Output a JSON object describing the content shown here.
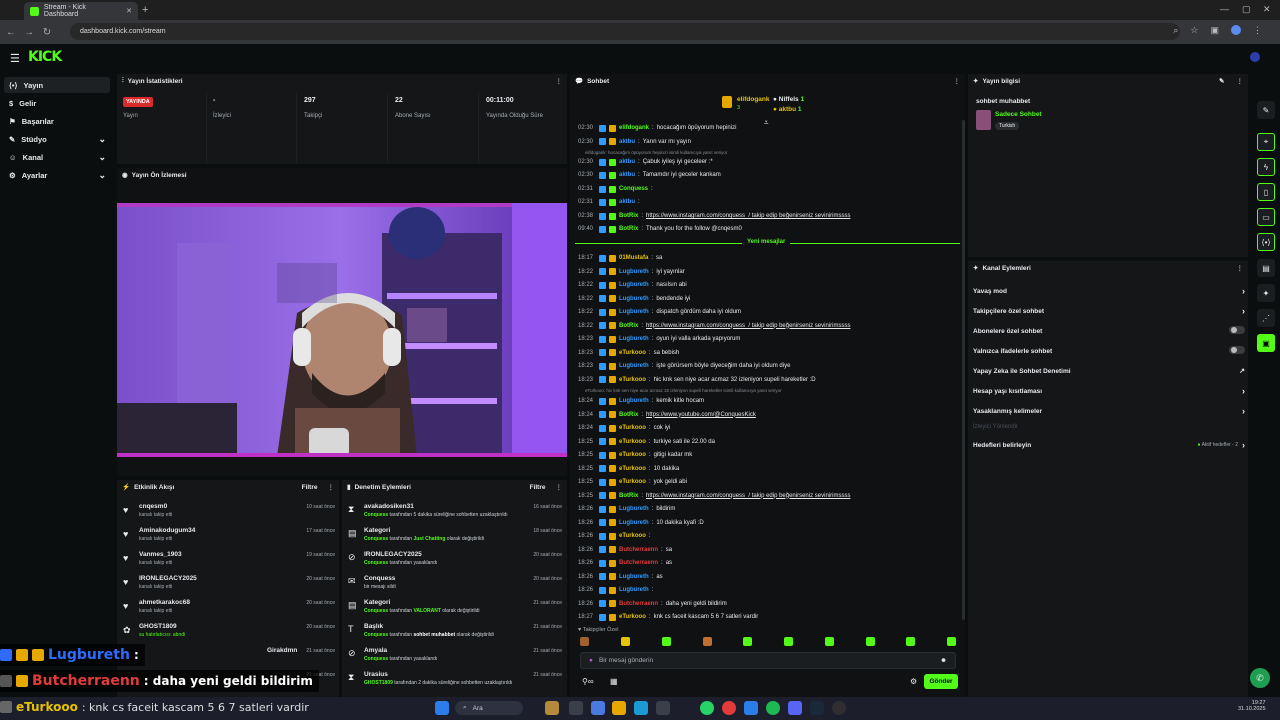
{
  "browser": {
    "tab_title": "Stream - Kick Dashboard",
    "url": "dashboard.kick.com/stream"
  },
  "brand": {
    "logo": "KICK",
    "accent": "#53fc18"
  },
  "sidebar": {
    "items": [
      {
        "label": "Yayın",
        "icon": "stream-icon"
      },
      {
        "label": "Gelir",
        "icon": "revenue-icon"
      },
      {
        "label": "Başarılar",
        "icon": "achievements-icon"
      },
      {
        "label": "Stüdyo",
        "icon": "studio-icon"
      },
      {
        "label": "Kanal",
        "icon": "channel-icon"
      },
      {
        "label": "Ayarlar",
        "icon": "settings-icon"
      }
    ]
  },
  "stats": {
    "title": "Yayın İstatistikleri",
    "live_badge": "YAYINDA",
    "items": [
      {
        "value": "",
        "label": "Yayın"
      },
      {
        "value": "-",
        "label": "İzleyici"
      },
      {
        "value": "297",
        "label": "Takipçi"
      },
      {
        "value": "22",
        "label": "Abone Sayısı"
      },
      {
        "value": "00:11:00",
        "label": "Yayında Olduğu Süre"
      }
    ]
  },
  "preview": {
    "title": "Yayın Ön İzlemesi"
  },
  "activity": {
    "title": "Etkinlik Akışı",
    "filter": "Filtre",
    "rows": [
      {
        "name": "cnqesm0",
        "sub": "kanalı takip etti",
        "time": "10 saat önce"
      },
      {
        "name": "Aminakodugum34",
        "sub": "kanalı takip etti",
        "time": "17 saat önce"
      },
      {
        "name": "Vanmes_1903",
        "sub": "kanalı takip etti",
        "time": "19 saat önce"
      },
      {
        "name": "IRONLEGACY2025",
        "sub": "kanalı takip etti",
        "time": "20 saat önce"
      },
      {
        "name": "ahmetkarakoc68",
        "sub": "kanalı takip etti",
        "time": "20 saat önce"
      },
      {
        "name": "GHOST1809",
        "sub": "su hatırlatıcısı: abndi",
        "time": "20 saat önce"
      },
      {
        "name": "Girakdmn",
        "sub": "",
        "time": "21 saat önce"
      },
      {
        "name": "",
        "sub": "",
        "time": "21 saat önce"
      }
    ]
  },
  "moderation": {
    "title": "Denetim Eylemleri",
    "filter": "Filtre",
    "rows": [
      {
        "name": "avakadosiken31",
        "actor": "Conquess",
        "sub": " tarafından 5 dakika süreliğine sohbetten uzaklaştırıldı",
        "time": "16 saat önce"
      },
      {
        "name": "Kategori",
        "actor": "Conquess",
        "sub": " tarafından ",
        "extra": "Just Chatting",
        "tail": " olarak değiştirildi",
        "time": "18 saat önce"
      },
      {
        "name": "IRONLEGACY2025",
        "actor": "Conquess",
        "sub": " tarafından yasaklandı",
        "time": "20 saat önce"
      },
      {
        "name": "Conquess",
        "actor": "",
        "sub": "bir mesajı sildi",
        "time": "20 saat önce"
      },
      {
        "name": "Kategori",
        "actor": "Conquess",
        "sub": " tarafından ",
        "extra": "VALORANT",
        "tail": " olarak değiştirildi",
        "time": "21 saat önce"
      },
      {
        "name": "Başlık",
        "actor": "Conquess",
        "sub": " tarafından ",
        "extra": "sohbet muhabbet",
        "tail": " olarak değiştirildi",
        "time": "21 saat önce"
      },
      {
        "name": "Amyala",
        "actor": "Conquess",
        "sub": " tarafından yasaklandı",
        "time": "21 saat önce"
      },
      {
        "name": "Urasius",
        "actor": "GHOST1809",
        "sub": " tarafından 2 dakika süreliğine sohbetten uzaklaştırıldı",
        "time": "21 saat önce"
      }
    ]
  },
  "chat": {
    "title": "Sohbet",
    "top_users": [
      {
        "name": "elifdogank",
        "count": "3"
      },
      {
        "name": "Niffels",
        "count": "1"
      },
      {
        "name": "aktbu",
        "count": "1"
      }
    ],
    "new_messages": "Yeni mesajlar",
    "followers_only": "Takipçiler Özel",
    "placeholder": "Bir mesaj gönderin",
    "send": "Gönder",
    "messages_old": [
      {
        "time": "02:30",
        "user": "elifdogank",
        "color": "#53fc18",
        "text": "hocacağım öpüyorum hepinizi"
      },
      {
        "time": "02:30",
        "user": "aktbu",
        "color": "#2f9bff",
        "text": "Yarın var mı yayın"
      },
      {
        "time": "02:30",
        "user": "aktbu",
        "color": "#2f9bff",
        "text": "Çabuk iyileş iyi geceleer :*"
      },
      {
        "time": "02:30",
        "user": "aktbu",
        "color": "#2f9bff",
        "text": "Tamamdır iyi geceler kankam"
      },
      {
        "time": "02:31",
        "user": "Conquess",
        "color": "#53fc18",
        "text": ""
      },
      {
        "time": "02:31",
        "user": "aktbu",
        "color": "#2f9bff",
        "text": ""
      },
      {
        "time": "02:38",
        "user": "BotRix",
        "color": "#53fc18",
        "text": "https://www.instagram.com/conquess_/ takip edip beğenirseniz sevinirimssss"
      },
      {
        "time": "09:40",
        "user": "BotRix",
        "color": "#53fc18",
        "text": "Thank you for the follow @cnqesm0"
      }
    ],
    "system_notes": [
      "elifdogank: hocacağım öpüyorum hepinizi isimli kullanıcıya yanıt veriyor",
      "eTurkooo: hic knk sen niye acar acmaz 32 izleniyon supeli hareketler isimli kullanıcıya yanıt veriyor"
    ],
    "messages_new": [
      {
        "time": "18:17",
        "user": "01Mustafa",
        "color": "#e6c200",
        "text": "sa"
      },
      {
        "time": "18:22",
        "user": "Lugbureth",
        "color": "#2f9bff",
        "text": "iyi yayınlar"
      },
      {
        "time": "18:22",
        "user": "Lugbureth",
        "color": "#2f9bff",
        "text": "nasılsın abi"
      },
      {
        "time": "18:22",
        "user": "Lugbureth",
        "color": "#2f9bff",
        "text": "bendende iyi"
      },
      {
        "time": "18:22",
        "user": "Lugbureth",
        "color": "#2f9bff",
        "text": "dispatch gördüm daha iyi oldum"
      },
      {
        "time": "18:22",
        "user": "BotRix",
        "color": "#53fc18",
        "text": "https://www.instagram.com/conquess_/ takip edip beğenirseniz sevinirimssss"
      },
      {
        "time": "18:23",
        "user": "Lugbureth",
        "color": "#2f9bff",
        "text": "oyun iyi valla arkada yapıyorum"
      },
      {
        "time": "18:23",
        "user": "eTurkooo",
        "color": "#e6c200",
        "text": "sa bebish"
      },
      {
        "time": "18:23",
        "user": "Lugbureth",
        "color": "#2f9bff",
        "text": "işte görürsem böyle diyeceğim daha iyi oldum diye"
      },
      {
        "time": "18:23",
        "user": "eTurkooo",
        "color": "#e6c200",
        "text": "hic knk sen niye acar acmaz 32 izleniyon supeli hareketler :D"
      },
      {
        "time": "18:24",
        "user": "Lugbureth",
        "color": "#2f9bff",
        "text": "kemik kitle hocam"
      },
      {
        "time": "18:24",
        "user": "BotRix",
        "color": "#53fc18",
        "text": "https://www.youtube.com/@ConquesKick"
      },
      {
        "time": "18:24",
        "user": "eTurkooo",
        "color": "#e6c200",
        "text": "cok iyi"
      },
      {
        "time": "18:25",
        "user": "eTurkooo",
        "color": "#e6c200",
        "text": "turkiye sati ile 22.00 da"
      },
      {
        "time": "18:25",
        "user": "eTurkooo",
        "color": "#e6c200",
        "text": "gitigi kadar mk"
      },
      {
        "time": "18:25",
        "user": "eTurkooo",
        "color": "#e6c200",
        "text": "10 dakika"
      },
      {
        "time": "18:25",
        "user": "eTurkooo",
        "color": "#e6c200",
        "text": "yok geldi abi"
      },
      {
        "time": "18:25",
        "user": "BotRix",
        "color": "#53fc18",
        "text": "https://www.instagram.com/conquess_/ takip edip beğenirseniz sevinirimssss"
      },
      {
        "time": "18:26",
        "user": "Lugbureth",
        "color": "#2f9bff",
        "text": "bildirim"
      },
      {
        "time": "18:26",
        "user": "Lugbureth",
        "color": "#2f9bff",
        "text": "10 dakika kyafi :D"
      },
      {
        "time": "18:26",
        "user": "eTurkooo",
        "color": "#e6c200",
        "text": ""
      },
      {
        "time": "18:26",
        "user": "Butcherraenn",
        "color": "#e23b3b",
        "text": "sa"
      },
      {
        "time": "18:26",
        "user": "Butcherraenn",
        "color": "#e23b3b",
        "text": "as"
      },
      {
        "time": "18:26",
        "user": "Lugbureth",
        "color": "#2f9bff",
        "text": "as"
      },
      {
        "time": "18:26",
        "user": "Lugbureth",
        "color": "#2f9bff",
        "text": ""
      },
      {
        "time": "18:26",
        "user": "Butcherraenn",
        "color": "#e23b3b",
        "text": "daha yeni geldi bildirim"
      },
      {
        "time": "18:27",
        "user": "eTurkooo",
        "color": "#e6c200",
        "text": "knk cs faceit kascam 5 6 7 satleri vardir"
      }
    ]
  },
  "stream_info": {
    "title": "Yayın bilgisi",
    "stream_title": "sohbet muhabbet",
    "category": "Sadece Sohbet",
    "tag": "Turkish"
  },
  "channel_actions": {
    "title": "Kanal Eylemleri",
    "items": [
      {
        "label": "Yavaş mod",
        "control": "chevron"
      },
      {
        "label": "Takipçilere özel sohbet",
        "control": "chevron"
      },
      {
        "label": "Abonelere özel sohbet",
        "control": "toggle"
      },
      {
        "label": "Yalnızca ifadelerle sohbet",
        "control": "toggle"
      },
      {
        "label": "Yapay Zeka ile Sohbet Denetimi",
        "control": "external"
      },
      {
        "label": "Hesap yaşı kısıtlaması",
        "control": "chevron"
      },
      {
        "label": "Yasaklanmış kelimeler",
        "control": "chevron"
      }
    ],
    "viewer_section": "İzleyici Yönlendir",
    "goals_label": "Hedefleri belirleyin",
    "goals_status": "Aktif hedefler - 2"
  },
  "overlay": [
    {
      "user": "Lugbureth",
      "color": "#2f6bff",
      "text": ":"
    },
    {
      "user": "Butcherraenn",
      "color": "#e23b3b",
      "text": ": daha yeni geldi bildirim"
    },
    {
      "user": "eTurkooo",
      "color": "#e6c200",
      "text": ": knk cs faceit kascam 5 6 7 satleri vardir"
    }
  ],
  "taskbar": {
    "search": "Ara",
    "time": "19:27",
    "date": "31.10.2025"
  }
}
